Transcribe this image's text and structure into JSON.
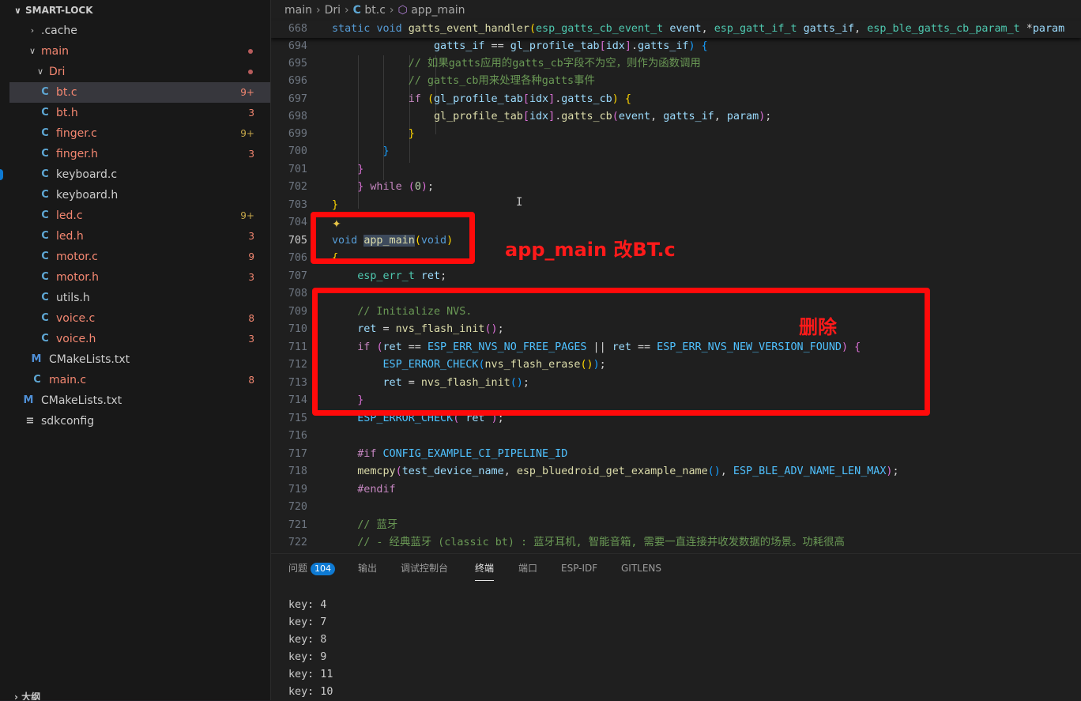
{
  "sidebar": {
    "title": "SMART-LOCK",
    "items": [
      {
        "label": ".cache",
        "badge": ""
      },
      {
        "label": "main",
        "badge": "●"
      },
      {
        "label": "Dri",
        "badge": "●"
      },
      {
        "label": "bt.c",
        "badge": "9+"
      },
      {
        "label": "bt.h",
        "badge": "3"
      },
      {
        "label": "finger.c",
        "badge": "9+"
      },
      {
        "label": "finger.h",
        "badge": "3"
      },
      {
        "label": "keyboard.c",
        "badge": ""
      },
      {
        "label": "keyboard.h",
        "badge": ""
      },
      {
        "label": "led.c",
        "badge": "9+"
      },
      {
        "label": "led.h",
        "badge": "3"
      },
      {
        "label": "motor.c",
        "badge": "9"
      },
      {
        "label": "motor.h",
        "badge": "3"
      },
      {
        "label": "utils.h",
        "badge": ""
      },
      {
        "label": "voice.c",
        "badge": "8"
      },
      {
        "label": "voice.h",
        "badge": "3"
      },
      {
        "label": "CMakeLists.txt",
        "badge": ""
      },
      {
        "label": "main.c",
        "badge": "8"
      },
      {
        "label": "CMakeLists.txt",
        "badge": ""
      },
      {
        "label": "sdkconfig",
        "badge": ""
      }
    ],
    "outline_label": "大纲"
  },
  "breadcrumb": [
    "main",
    "Dri",
    "bt.c",
    "app_main"
  ],
  "editor": {
    "sticky_line_number": "668",
    "line_numbers": [
      "694",
      "695",
      "696",
      "697",
      "698",
      "699",
      "700",
      "701",
      "702",
      "703",
      "704",
      "705",
      "706",
      "707",
      "708",
      "709",
      "710",
      "711",
      "712",
      "713",
      "714",
      "715",
      "716",
      "717",
      "718",
      "719",
      "720",
      "721",
      "722"
    ],
    "current_line": "705"
  },
  "annotations": {
    "app_main_note": "app_main 改BT.c",
    "delete_note": "删除"
  },
  "panel": {
    "tabs": [
      "问题",
      "输出",
      "调试控制台",
      "终端",
      "端口",
      "ESP-IDF",
      "GITLENS"
    ],
    "problems_count": "104",
    "active_tab": "终端",
    "terminal_lines": [
      "key: 4",
      "key: 7",
      "key: 8",
      "key: 9",
      "key: 11",
      "key: 10"
    ]
  },
  "colors": {
    "accent": "#0e7ad3",
    "annotation_red": "#ff0a0a",
    "error_file": "#f48771"
  }
}
